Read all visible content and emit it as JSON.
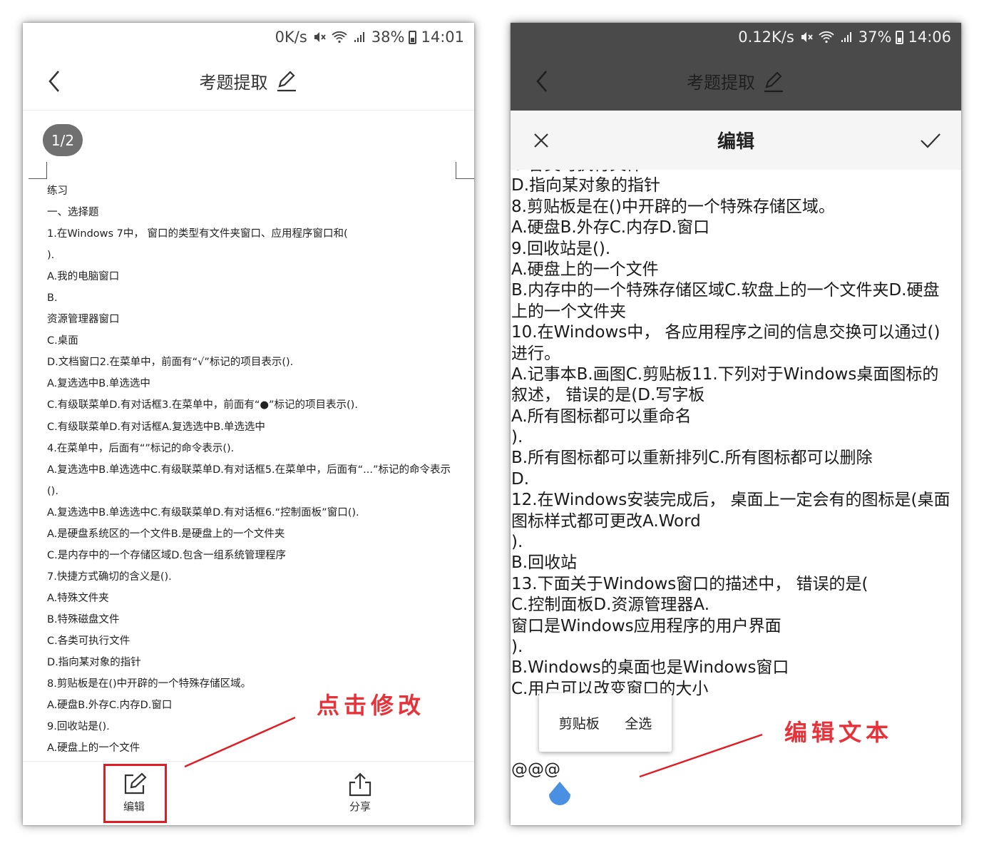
{
  "left_screen": {
    "status": {
      "speed": "0K/s",
      "battery": "38%",
      "time": "14:01"
    },
    "title": "考题提取",
    "page_indicator": "1/2",
    "document_lines": [
      "练习",
      "一、选择题",
      "1.在Windows 7中， 窗口的类型有文件夹窗口、应用程序窗口和(",
      ").",
      "A.我的电脑窗口",
      "B.",
      "资源管理器窗口",
      "C.桌面",
      "D.文档窗口2.在菜单中，前面有“√”标记的项目表示().",
      "A.复选选中B.单选选中",
      "C.有级联菜单D.有对话框3.在菜单中，前面有“●”标记的项目表示().",
      "C.有级联菜单D.有对话框A.复选选中B.单选选中",
      "4.在菜单中，后面有“”标记的命令表示().",
      "A.复选选中B.单选选中C.有级联菜单D.有对话框5.在菜单中，后面有“...”标记的命令表示",
      "().",
      "A.复选选中B.单选选中C.有级联菜单D.有对话框6.“控制面板”窗口().",
      "A.是硬盘系统区的一个文件B.是硬盘上的一个文件夹",
      "C.是内存中的一个存储区域D.包含一组系统管理程序",
      "7.快捷方式确切的含义是().",
      "A.特殊文件夹",
      "B.特殊磁盘文件",
      "C.各类可执行文件",
      "D.指向某对象的指针",
      "8.剪贴板是在()中开辟的一个特殊存储区域。",
      "A.硬盘B.外存C.内存D.窗口",
      "9.回收站是().",
      "A.硬盘上的一个文件"
    ],
    "bottom_bar": {
      "edit_label": "编辑",
      "share_label": "分享"
    },
    "annotation": "点击修改"
  },
  "right_screen": {
    "status": {
      "speed": "0.12K/s",
      "battery": "37%",
      "time": "14:06"
    },
    "title": "考题提取",
    "edit_title": "编辑",
    "edit_lines": [
      "C.各类可执行文件",
      "D.指向某对象的指针",
      "8.剪贴板是在()中开辟的一个特殊存储区域。",
      "A.硬盘B.外存C.内存D.窗口",
      "9.回收站是().",
      "A.硬盘上的一个文件",
      "B.内存中的一个特殊存储区域C.软盘上的一个文件夹D.硬盘",
      "上的一个文件夹",
      "10.在Windows中， 各应用程序之间的信息交换可以通过()",
      "进行。",
      "A.记事本B.画图C.剪贴板11.下列对于Windows桌面图标的",
      "叙述， 错误的是(D.写字板",
      "A.所有图标都可以重命名",
      ").",
      "B.所有图标都可以重新排列C.所有图标都可以删除",
      "D.",
      "12.在Windows安装完成后， 桌面上一定会有的图标是(桌面",
      "图标样式都可更改A.Word",
      ").",
      "B.回收站",
      "13.下面关于Windows窗口的描述中， 错误的是(",
      "C.控制面板D.资源管理器A.",
      "窗口是Windows应用程序的用户界面",
      ").",
      "B.Windows的桌面也是Windows窗口",
      "C.用户可以改变窗口的大小"
    ],
    "context_menu": {
      "clipboard": "剪贴板",
      "select_all": "全选"
    },
    "input_tail": "@@@",
    "annotation": "编辑文本"
  },
  "colors": {
    "accent_red": "#e01d24",
    "handle_blue": "#4a90e2",
    "dark_bar": "#4a4a4a"
  }
}
